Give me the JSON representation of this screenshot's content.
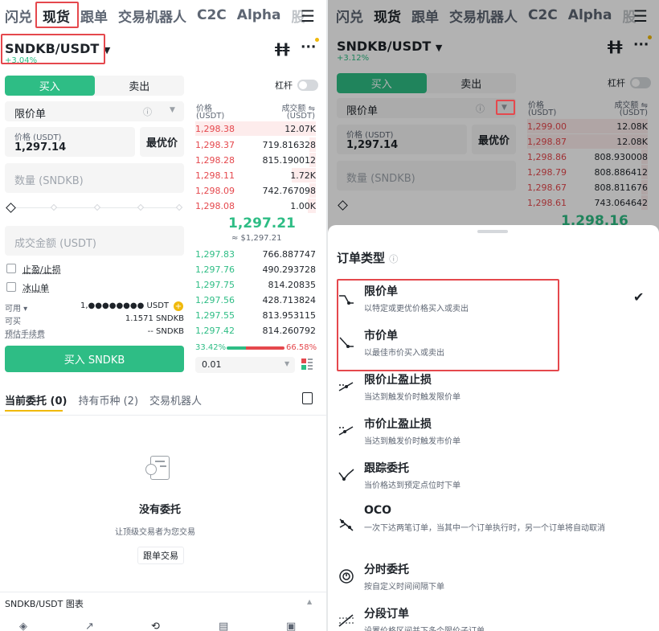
{
  "left": {
    "nav": [
      "闪兑",
      "现货",
      "跟单",
      "交易机器人",
      "C2C",
      "Alpha",
      "股"
    ],
    "pair": "SNDKB/USDT",
    "pair_change": "+3.04%",
    "buy_tab": "买入",
    "sell_tab": "卖出",
    "leverage_label": "杠杆",
    "order_type": "限价单",
    "price_label": "价格 (USDT)",
    "price_value": "1,297.14",
    "best_price_label": "最优价",
    "qty_placeholder": "数量 (SNDKB)",
    "amount_placeholder": "成交金额 (USDT)",
    "tpsl_label": "止盈/止损",
    "iceberg_label": "冰山单",
    "available_label": "可用",
    "available_value": "1,●●●●●●●● USDT",
    "buyable_label": "可买",
    "buyable_value": "1.1571 SNDKB",
    "fee_label": "预估手续费",
    "fee_value": "-- SNDKB",
    "buy_button": "买入 SNDKB",
    "ob_price_header": "价格",
    "ob_price_unit": "(USDT)",
    "ob_amount_header": "成交额 ⇋",
    "ob_amount_unit": "(USDT)",
    "asks": [
      {
        "p": "1,298.38",
        "v": "12.07K"
      },
      {
        "p": "1,298.37",
        "v": "719.816328"
      },
      {
        "p": "1,298.28",
        "v": "815.190012"
      },
      {
        "p": "1,298.11",
        "v": "1.72K"
      },
      {
        "p": "1,298.09",
        "v": "742.767098"
      },
      {
        "p": "1,298.08",
        "v": "1.00K"
      }
    ],
    "mid_price": "1,297.21",
    "mid_fiat": "≈ $1,297.21",
    "bids": [
      {
        "p": "1,297.83",
        "v": "766.887747"
      },
      {
        "p": "1,297.76",
        "v": "490.293728"
      },
      {
        "p": "1,297.75",
        "v": "814.20835"
      },
      {
        "p": "1,297.56",
        "v": "428.713824"
      },
      {
        "p": "1,297.55",
        "v": "813.953115"
      },
      {
        "p": "1,297.42",
        "v": "814.260792"
      }
    ],
    "buy_ratio": "33.42%",
    "sell_ratio": "66.58%",
    "buy_ratio_value": 0.3342,
    "precision": "0.01",
    "tabs": [
      "当前委托 (0)",
      "持有币种 (2)",
      "交易机器人"
    ],
    "empty_title": "没有委托",
    "empty_sub": "让顶级交易者为您交易",
    "copy_trade": "跟单交易",
    "chart_bar": "SNDKB/USDT 图表"
  },
  "right": {
    "nav": [
      "闪兑",
      "现货",
      "跟单",
      "交易机器人",
      "C2C",
      "Alpha",
      "股"
    ],
    "pair": "SNDKB/USDT",
    "pair_change": "+3.12%",
    "buy_tab": "买入",
    "sell_tab": "卖出",
    "leverage_label": "杠杆",
    "order_type": "限价单",
    "price_label": "价格 (USDT)",
    "price_value": "1,297.14",
    "best_price_label": "最优价",
    "qty_placeholder": "数量 (SNDKB)",
    "ob_price_header": "价格",
    "ob_price_unit": "(USDT)",
    "ob_amount_header": "成交额 ⇋",
    "ob_amount_unit": "(USDT)",
    "asks": [
      {
        "p": "1,299.00",
        "v": "12.08K"
      },
      {
        "p": "1,298.87",
        "v": "12.08K"
      },
      {
        "p": "1,298.86",
        "v": "808.930008"
      },
      {
        "p": "1,298.79",
        "v": "808.886412"
      },
      {
        "p": "1,298.67",
        "v": "808.811676"
      },
      {
        "p": "1,298.61",
        "v": "743.064642"
      }
    ],
    "mid_price": "1,298.16",
    "sheet_title": "订单类型",
    "options": [
      {
        "title": "限价单",
        "desc": "以特定或更优价格买入或卖出"
      },
      {
        "title": "市价单",
        "desc": "以最佳市价买入或卖出"
      },
      {
        "title": "限价止盈止损",
        "desc": "当达到触发价时触发限价单"
      },
      {
        "title": "市价止盈止损",
        "desc": "当达到触发价时触发市价单"
      },
      {
        "title": "跟踪委托",
        "desc": "当价格达到预定点位时下单"
      },
      {
        "title": "OCO",
        "desc": "一次下达两笔订单，当其中一个订单执行时，另一个订单将自动取消"
      },
      {
        "title": "分时委托",
        "desc": "按自定义时间间隔下单"
      },
      {
        "title": "分段订单",
        "desc": "设置价格区间并下多个限价子订单"
      }
    ]
  },
  "colors": {
    "green": "#2ebd85",
    "red": "#e5484d",
    "highlight": "#e5484d"
  }
}
